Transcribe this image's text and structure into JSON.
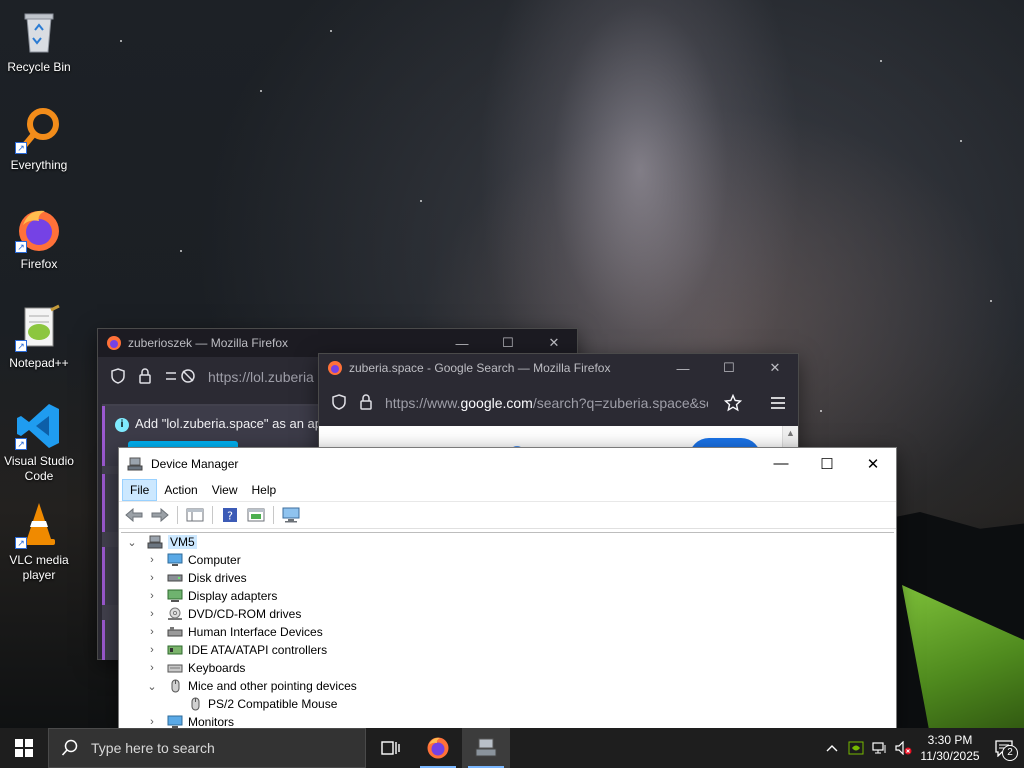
{
  "desktop": {
    "icons": [
      {
        "label": "Recycle Bin"
      },
      {
        "label": "Everything"
      },
      {
        "label": "Firefox"
      },
      {
        "label": "Notepad++"
      },
      {
        "label": "Visual Studio Code"
      },
      {
        "label": "VLC media player"
      }
    ]
  },
  "firefox_back": {
    "title": "zuberioszek — Mozilla Firefox",
    "url": "https://lol.zuberia",
    "notice": "Add \"lol.zuberia.space\" as an applic"
  },
  "firefox_front": {
    "title": "zuberia.space - Google Search — Mozilla Firefox",
    "url_prefix": "https://www.",
    "url_domain": "google.com",
    "url_rest": "/search?q=zuberia.space&sei="
  },
  "device_manager": {
    "title": "Device Manager",
    "menu": [
      "File",
      "Action",
      "View",
      "Help"
    ],
    "root": "VM5",
    "tree": [
      {
        "label": "Computer",
        "expanded": false
      },
      {
        "label": "Disk drives",
        "expanded": false
      },
      {
        "label": "Display adapters",
        "expanded": false
      },
      {
        "label": "DVD/CD-ROM drives",
        "expanded": false
      },
      {
        "label": "Human Interface Devices",
        "expanded": false
      },
      {
        "label": "IDE ATA/ATAPI controllers",
        "expanded": false
      },
      {
        "label": "Keyboards",
        "expanded": false
      },
      {
        "label": "Mice and other pointing devices",
        "expanded": true
      },
      {
        "label": "PS/2 Compatible Mouse",
        "child": true
      },
      {
        "label": "Monitors",
        "expanded": false
      }
    ]
  },
  "taskbar": {
    "search_placeholder": "Type here to search",
    "time": "3:30 PM",
    "date": "11/30/2025",
    "notification_count": "2"
  }
}
